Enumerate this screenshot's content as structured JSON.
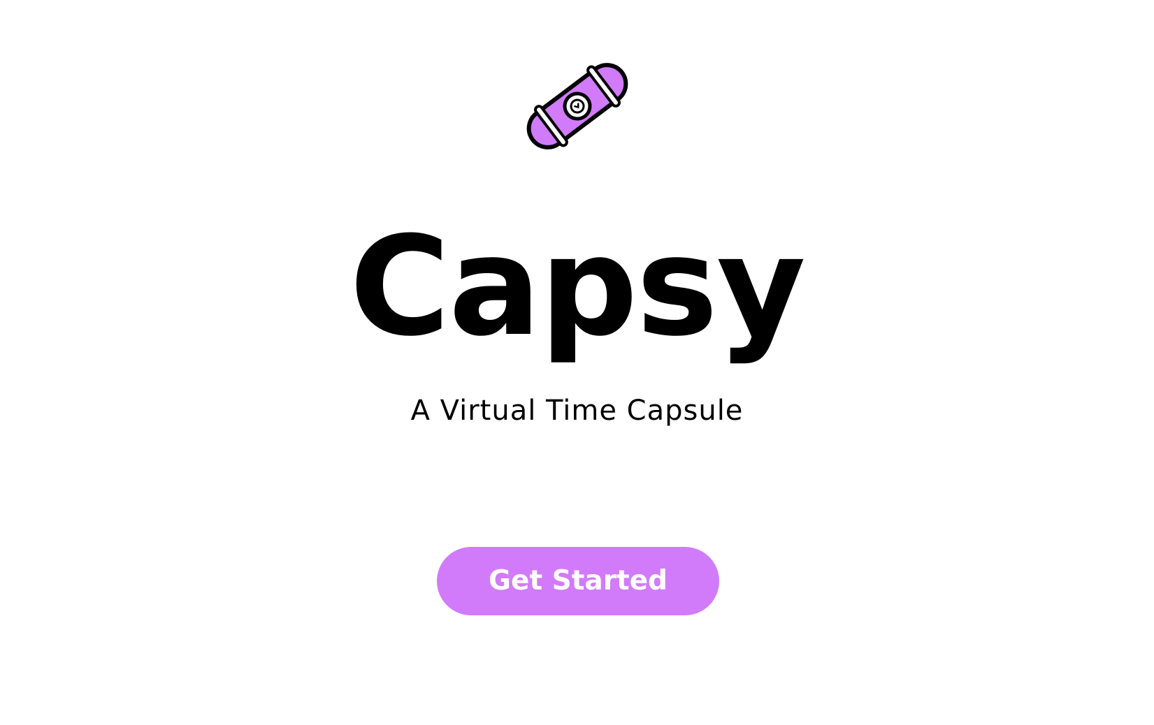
{
  "brand": {
    "accent_color": "#d17bfb",
    "logo_icon": "skateboard-icon"
  },
  "hero": {
    "title": "Capsy",
    "subtitle": "A Virtual Time Capsule"
  },
  "cta": {
    "label": "Get Started"
  }
}
